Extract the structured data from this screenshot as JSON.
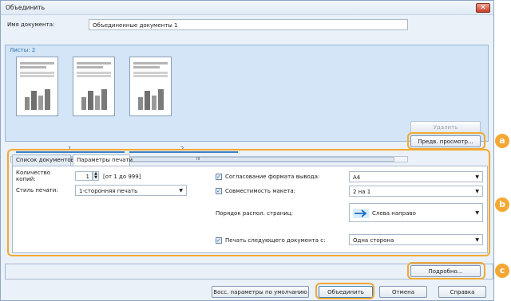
{
  "window": {
    "title": "Объединить",
    "close_icon": "close-icon"
  },
  "doc_name": {
    "label": "Имя документа:",
    "value": "Объединенные документы 1"
  },
  "pages": {
    "header": "Листы: 2",
    "page_numbers": [
      "1",
      "2"
    ],
    "scroll_label": "III",
    "delete_label": "Удалить",
    "preview_label": "Предв. просмотр..."
  },
  "tabs": {
    "doc_list": "Список документов",
    "print_settings": "Параметры печати"
  },
  "settings": {
    "copies_label": "Количество копий:",
    "copies_value": "1",
    "copies_range": "[от 1 до 999]",
    "print_style_label": "Стиль печати:",
    "print_style_value": "1-сторонняя печать",
    "fit_output_label": "Согласование формата вывода:",
    "fit_output_value": "A4",
    "layout_compat_label": "Совместимость макета:",
    "layout_compat_value": "2 на 1",
    "page_order_label": "Порядок распол. страниц:",
    "page_order_value": "Слева направо",
    "next_doc_label": "Печать следующего документа с:",
    "next_doc_value": "Одна сторона"
  },
  "details_label": "Подробно...",
  "footer": {
    "restore_label": "Восс. параметры по умолчанию",
    "merge_label": "Объединить",
    "cancel_label": "Отмена",
    "help_label": "Справка"
  },
  "callouts": [
    "a",
    "b",
    "c"
  ],
  "colors": {
    "accent": "#f3a833",
    "page_number": "#1d5fa8",
    "pane_bg": "#d3e5f6"
  }
}
